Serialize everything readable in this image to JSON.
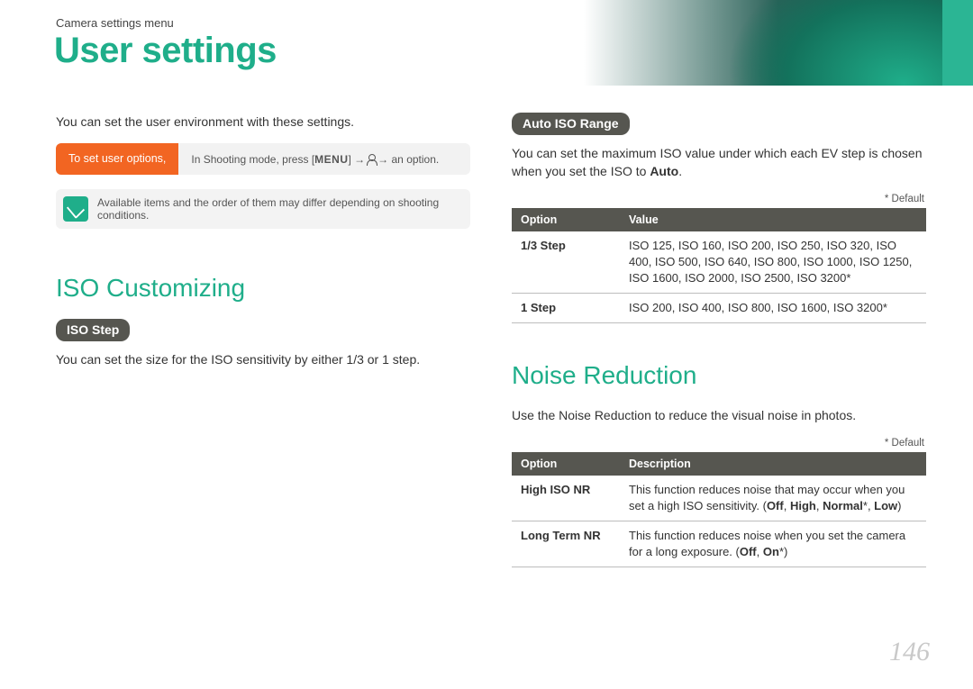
{
  "header": {
    "breadcrumb": "Camera settings menu",
    "title": "User settings"
  },
  "left": {
    "intro": "You can set the user environment with these settings.",
    "set_options_label": "To set user options,",
    "set_options_instr_pre": "In Shooting mode, press [",
    "set_options_menu": "MENU",
    "set_options_instr_post": "] → ",
    "set_options_instr_end": " → an option.",
    "note": "Available items and the order of them may differ depending on shooting conditions.",
    "section_title": "ISO Customizing",
    "iso_step_label": "ISO Step",
    "iso_step_text": "You can set the size for the ISO sensitivity by either 1/3 or 1 step."
  },
  "right": {
    "auto_iso_label": "Auto ISO Range",
    "auto_iso_text_1": "You can set the maximum ISO value under which each EV step is chosen when you set the ISO to ",
    "auto_iso_bold": "Auto",
    "default_marker": "* Default",
    "iso_table": {
      "headers": [
        "Option",
        "Value"
      ],
      "rows": [
        {
          "option": "1/3 Step",
          "value": "ISO 125, ISO 160, ISO 200, ISO 250, ISO 320, ISO 400, ISO 500, ISO 640, ISO 800, ISO 1000, ISO 1250, ISO 1600, ISO 2000, ISO 2500, ISO 3200*"
        },
        {
          "option": "1 Step",
          "value": "ISO 200, ISO 400, ISO 800, ISO 1600, ISO 3200*"
        }
      ]
    },
    "nr_title": "Noise Reduction",
    "nr_text": "Use the Noise Reduction to reduce the visual noise in photos.",
    "nr_table": {
      "headers": [
        "Option",
        "Description"
      ],
      "rows": [
        {
          "option": "High ISO NR",
          "desc_pre": "This function reduces noise that may occur when you set a high ISO sensitivity. (",
          "b1": "Off",
          "s1": ", ",
          "b2": "High",
          "s2": ", ",
          "b3": "Normal",
          "star": "*",
          "s3": ", ",
          "b4": "Low",
          "desc_post": ")"
        },
        {
          "option": "Long Term NR",
          "desc_pre": "This function reduces noise when you set the camera for a long exposure. (",
          "b1": "Off",
          "s1": ", ",
          "b2": "On",
          "star": "*",
          "desc_post": ")"
        }
      ]
    }
  },
  "page_number": "146"
}
